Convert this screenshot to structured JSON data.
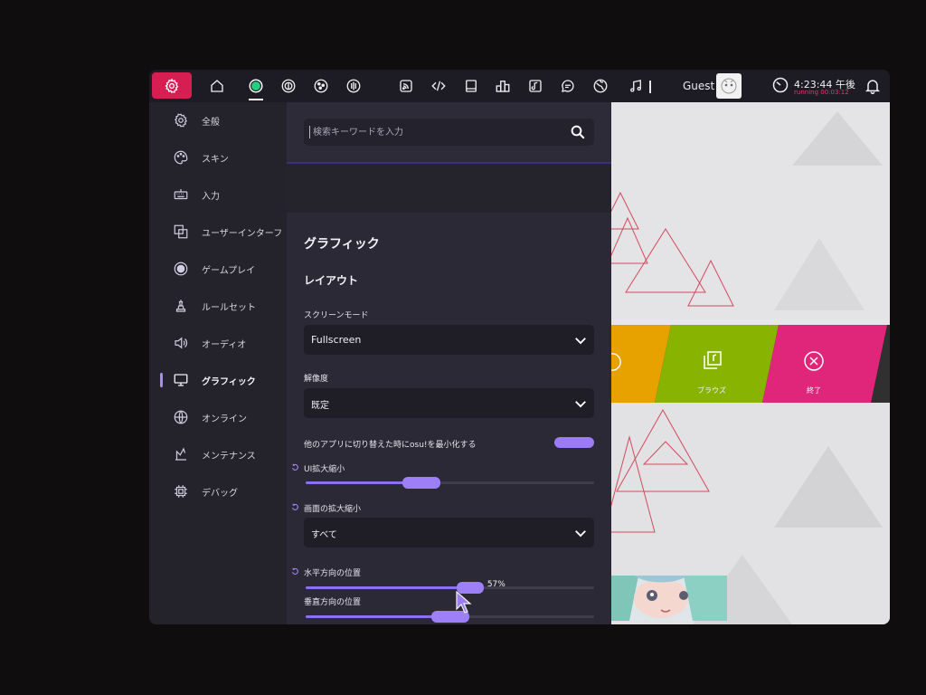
{
  "toolbar": {
    "icons": [
      "gear-icon",
      "home-icon",
      "ruleset-osu-icon",
      "ruleset-taiko-icon",
      "ruleset-catch-icon",
      "ruleset-mania-icon",
      "rss-icon",
      "code-icon",
      "wiki-icon",
      "ranking-icon",
      "beatmap-listing-icon",
      "chat-icon",
      "world-icon",
      "music-icon"
    ],
    "user_name": "Guest",
    "clock_time": "4:23:44 午後",
    "clock_running": "running 00:03:12",
    "accent_color": "#d61e52"
  },
  "sidebar": {
    "items": [
      {
        "label": "全般",
        "icon": "gear-icon"
      },
      {
        "label": "スキン",
        "icon": "palette-icon"
      },
      {
        "label": "入力",
        "icon": "keyboard-icon"
      },
      {
        "label": "ユーザーインターフ",
        "icon": "layout-icon"
      },
      {
        "label": "ゲームプレイ",
        "icon": "gameplay-icon"
      },
      {
        "label": "ルールセット",
        "icon": "chess-icon"
      },
      {
        "label": "オーディオ",
        "icon": "speaker-icon"
      },
      {
        "label": "グラフィック",
        "icon": "monitor-icon",
        "active": true
      },
      {
        "label": "オンライン",
        "icon": "globe-icon"
      },
      {
        "label": "メンテナンス",
        "icon": "wrench-icon"
      },
      {
        "label": "デバッグ",
        "icon": "chip-icon"
      }
    ]
  },
  "search": {
    "placeholder": "検索キーワードを入力"
  },
  "graphics": {
    "section_title": "グラフィック",
    "layout_title": "レイアウト",
    "screen_mode_label": "スクリーンモード",
    "screen_mode_value": "Fullscreen",
    "resolution_label": "解像度",
    "resolution_value": "既定",
    "minimize_label": "他のアプリに切り替えた時にosu!を最小化する",
    "minimize_enabled": true,
    "ui_scale_label": "UI拡大縮小",
    "ui_scale_value": 0.4,
    "screen_scaling_label": "画面の拡大縮小",
    "screen_scaling_value": "すべて",
    "horizontal_position_label": "水平方向の位置",
    "horizontal_position_value": 0.57,
    "horizontal_position_display": "57%",
    "vertical_position_label": "垂直方向の位置",
    "vertical_position_value": 0.5
  },
  "background": {
    "tiles": [
      {
        "label": "",
        "color": "#e8a200"
      },
      {
        "label": "ブラウズ",
        "color": "#88b300"
      },
      {
        "label": "終了",
        "color": "#e0267a"
      }
    ]
  }
}
